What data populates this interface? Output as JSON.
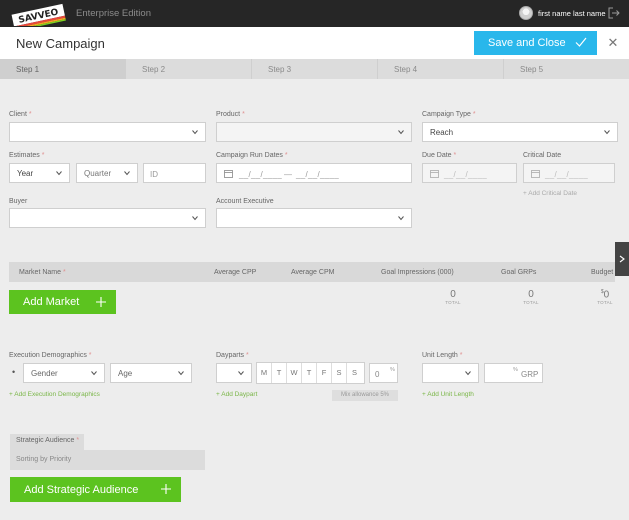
{
  "app": {
    "logo_text": "SAVVEO",
    "edition": "Enterprise Edition",
    "user_name": "first name last name"
  },
  "header": {
    "title": "New Campaign",
    "save_label": "Save and Close"
  },
  "steps": [
    "Step 1",
    "Step 2",
    "Step 3",
    "Step 4",
    "Step 5"
  ],
  "form": {
    "client": {
      "label": "Client",
      "required": "*",
      "value": ""
    },
    "product": {
      "label": "Product",
      "required": "*",
      "value": ""
    },
    "campaign_type": {
      "label": "Campaign Type",
      "required": "*",
      "value": "Reach"
    },
    "estimates": {
      "label": "Estimates",
      "required": "*",
      "year": "Year",
      "quarter": "Quarter",
      "id_placeholder": "ID"
    },
    "run_dates": {
      "label": "Campaign Run Dates",
      "required": "*",
      "start": "__/__/____",
      "separator": "—",
      "end": "__/__/____"
    },
    "due_date": {
      "label": "Due Date",
      "required": "*",
      "value": "__/__/____"
    },
    "critical_date": {
      "label": "Critical Date",
      "value": "__/__/____",
      "add_link": "+ Add Critical Date"
    },
    "buyer": {
      "label": "Buyer",
      "value": ""
    },
    "account_executive": {
      "label": "Account Executive",
      "value": ""
    }
  },
  "markets": {
    "columns": [
      "Market Name",
      "Average CPP",
      "Average CPM",
      "Goal Impressions (000)",
      "Goal GRPs",
      "Budget"
    ],
    "market_required": "*",
    "add_label": "Add Market",
    "totals": [
      {
        "value": "0",
        "label": "TOTAL"
      },
      {
        "value": "0",
        "label": "TOTAL"
      },
      {
        "prefix": "$",
        "value": "0",
        "label": "TOTAL"
      }
    ]
  },
  "demographics": {
    "label": "Execution Demographics",
    "required": "*",
    "bullet": "•",
    "gender": "Gender",
    "age": "Age",
    "add_link": "+ Add Execution Demographics"
  },
  "dayparts": {
    "label": "Dayparts",
    "required": "*",
    "days": [
      "M",
      "T",
      "W",
      "T",
      "F",
      "S",
      "S"
    ],
    "percent_value": "0",
    "percent_sign": "%",
    "add_link": "+ Add Daypart",
    "mix_allowance": "Mix allowance 5%"
  },
  "unit_length": {
    "label": "Unit Length",
    "required": "*",
    "percent_sign": "%",
    "grp": "GRP",
    "add_link": "+ Add Unit Length"
  },
  "strategic": {
    "header": "Strategic Audience",
    "required": "*",
    "sort_label": "Sorting by Priority",
    "add_label": "Add Strategic Audience"
  },
  "colors": {
    "accent_blue": "#29b7eb",
    "accent_green": "#5cc31f",
    "link_green": "#7ab648",
    "topbar": "#262626"
  }
}
